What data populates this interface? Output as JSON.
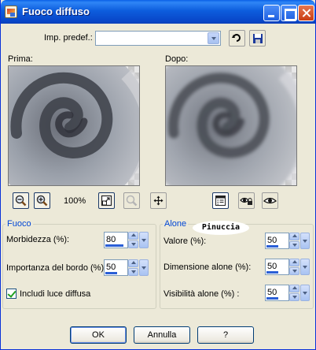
{
  "window": {
    "title": "Fuoco diffuso"
  },
  "preset": {
    "label": "Imp. predef.:",
    "value": ""
  },
  "previews": {
    "before_label": "Prima:",
    "after_label": "Dopo:"
  },
  "zoom": {
    "value": "100%"
  },
  "fuoco": {
    "title": "Fuoco",
    "softness_label": "Morbidezza (%):",
    "softness_value": "80",
    "softness_level": 0.8,
    "edge_label": "Importanza del bordo (%):",
    "edge_value": "50",
    "edge_level": 0.5,
    "include_label": "Includi luce diffusa",
    "include_checked": true
  },
  "alone": {
    "title": "Alone",
    "value_label": "Valore (%):",
    "value_value": "50",
    "value_level": 0.5,
    "size_label": "Dimensione alone (%):",
    "size_value": "50",
    "size_level": 0.5,
    "visibility_label": "Visibilità alone (%) :",
    "visibility_value": "50",
    "visibility_level": 0.5
  },
  "watermark": "Pinuccia",
  "buttons": {
    "ok": "OK",
    "cancel": "Annulla",
    "help": "?"
  },
  "colors": {
    "titlebar": "#0a5fe6",
    "group_title": "#0046d5",
    "dialog_bg": "#ece9d8"
  }
}
